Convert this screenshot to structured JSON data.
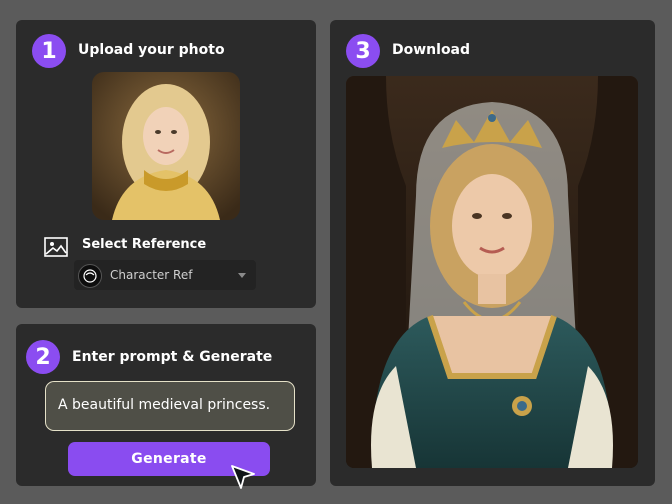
{
  "steps": [
    {
      "number": "1",
      "title": "Upload your photo"
    },
    {
      "number": "2",
      "title": "Enter prompt & Generate"
    },
    {
      "number": "3",
      "title": "Download"
    }
  ],
  "upload": {
    "reference_label": "Select Reference",
    "reference_value": "Character Ref"
  },
  "prompt": {
    "value": "A beautiful medieval princess.",
    "generate_label": "Generate"
  },
  "colors": {
    "accent": "#8b4df1",
    "background": "#5b5b5b",
    "panel": "#2b2b2b"
  },
  "icons": {
    "reference": "image-icon",
    "dropdown": "chevron-down-icon",
    "cursor": "cursor-icon"
  }
}
